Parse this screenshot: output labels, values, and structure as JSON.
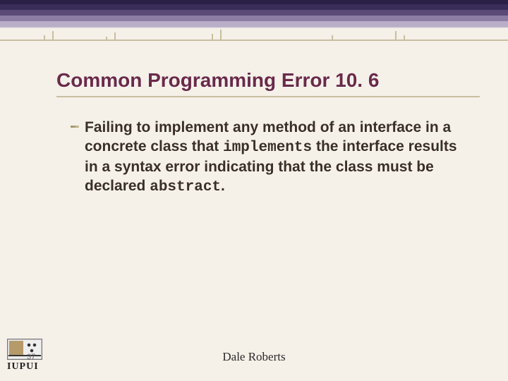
{
  "slide": {
    "title": "Common Programming Error 10. 6",
    "body_parts": {
      "p1": "Failing to implement any method of an interface in a concrete class that ",
      "kw1": "implements",
      "p2": " the interface results in a syntax error indicating that the class must be declared ",
      "kw2": "abstract",
      "p3": "."
    },
    "number": "37",
    "footer_author": "Dale Roberts",
    "logo_text": "IUPUI"
  }
}
